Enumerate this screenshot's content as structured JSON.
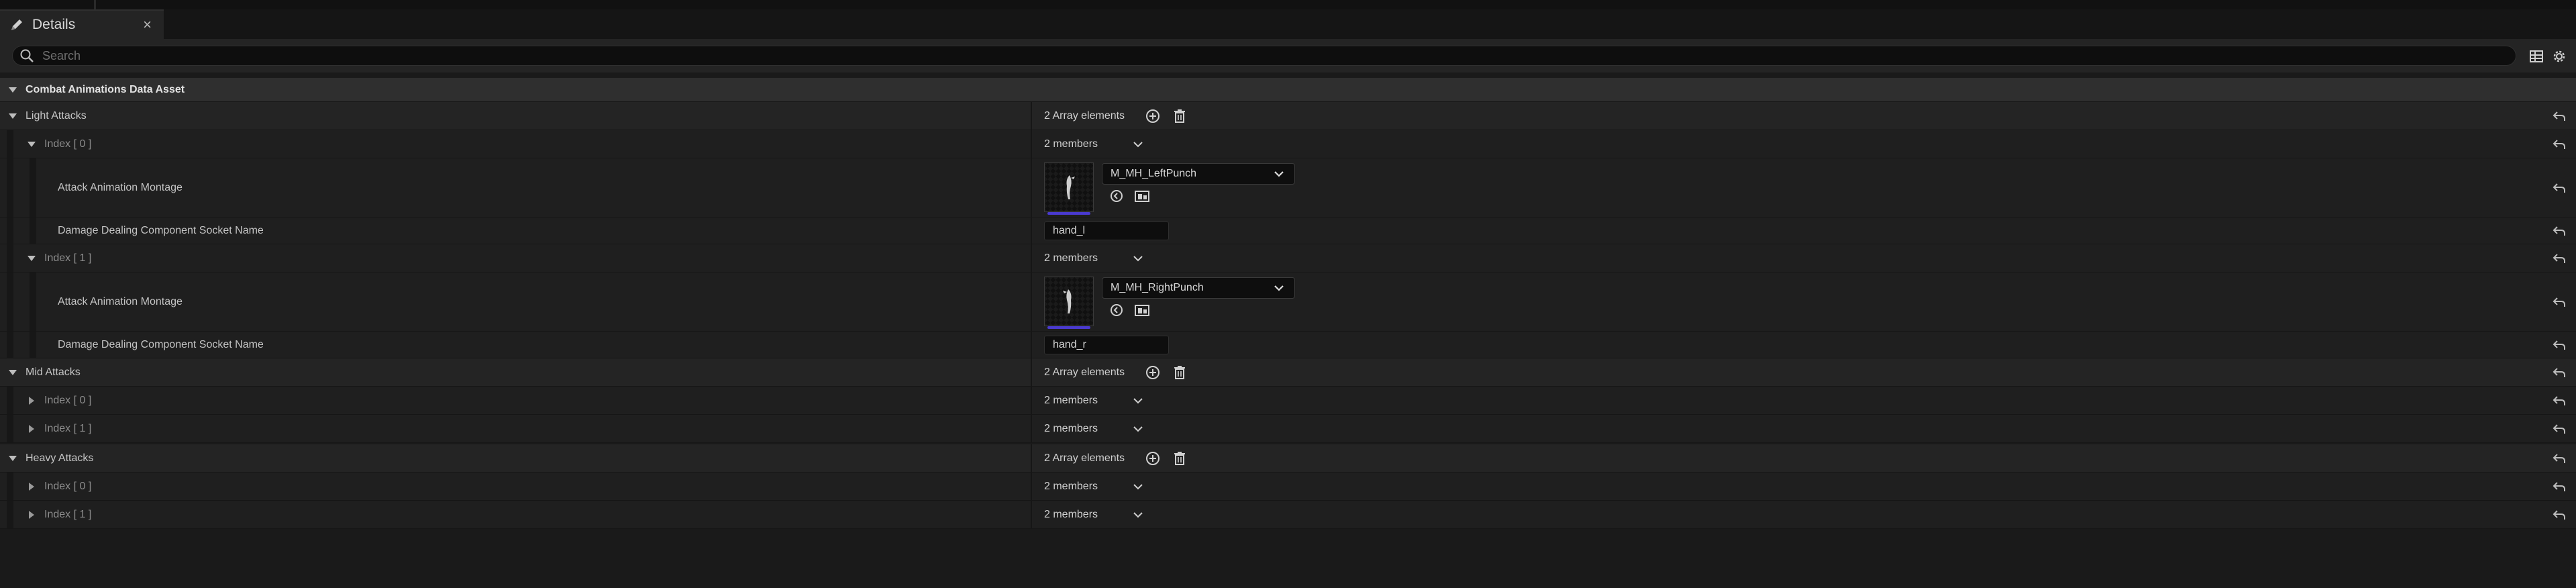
{
  "tab": {
    "label": "Details",
    "close": "×"
  },
  "search": {
    "placeholder": "Search"
  },
  "category": {
    "title": "Combat Animations Data Asset"
  },
  "light": {
    "label": "Light Attacks",
    "count": "2 Array elements",
    "items": [
      {
        "label": "Index [ 0 ]",
        "members": "2 members",
        "montage_label": "Attack Animation Montage",
        "montage_value": "M_MH_LeftPunch",
        "socket_label": "Damage Dealing Component Socket Name",
        "socket_value": "hand_l"
      },
      {
        "label": "Index [ 1 ]",
        "members": "2 members",
        "montage_label": "Attack Animation Montage",
        "montage_value": "M_MH_RightPunch",
        "socket_label": "Damage Dealing Component Socket Name",
        "socket_value": "hand_r"
      }
    ]
  },
  "mid": {
    "label": "Mid Attacks",
    "count": "2 Array elements",
    "items": [
      {
        "label": "Index [ 0 ]",
        "members": "2 members"
      },
      {
        "label": "Index [ 1 ]",
        "members": "2 members"
      }
    ]
  },
  "heavy": {
    "label": "Heavy Attacks",
    "count": "2 Array elements",
    "items": [
      {
        "label": "Index [ 0 ]",
        "members": "2 members"
      },
      {
        "label": "Index [ 1 ]",
        "members": "2 members"
      }
    ]
  },
  "colors": {
    "accent": "#4a3ad0",
    "panel": "#242424",
    "category": "#2f2f2f"
  },
  "icons": {
    "tab": "pencil-icon",
    "search": "search-icon",
    "table": "table-view-icon",
    "settings": "gear-icon",
    "add": "plus-circle-icon",
    "delete": "trash-icon",
    "reset": "reset-arrow-icon",
    "expand": "triangle-down-icon",
    "collapse": "triangle-right-icon",
    "dropdown": "chevron-down-icon",
    "use": "use-selected-icon",
    "browse": "browse-folder-icon"
  }
}
